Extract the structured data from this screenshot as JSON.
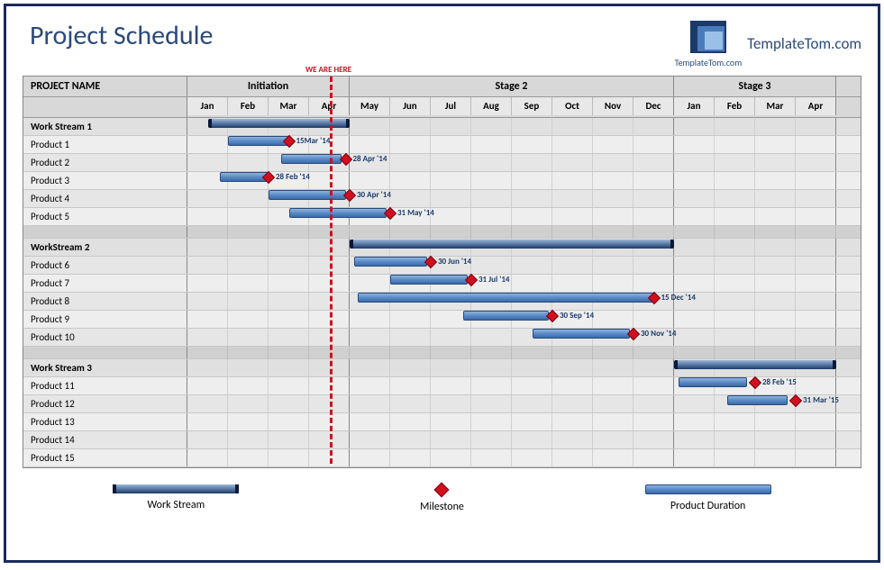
{
  "title": "Project Schedule",
  "brand": {
    "name_small": "TemplateTom.com",
    "name_big": "TemplateTom.com"
  },
  "now_label": "WE ARE HERE",
  "table": {
    "name_header": "PROJECT NAME",
    "groups": [
      {
        "label": "Initiation",
        "span": 4
      },
      {
        "label": "Stage 2",
        "span": 8
      },
      {
        "label": "Stage 3",
        "span": 4
      }
    ],
    "months": [
      "Jan",
      "Feb",
      "Mar",
      "Apr",
      "May",
      "Jun",
      "Jul",
      "Aug",
      "Sep",
      "Oct",
      "Nov",
      "Dec",
      "Jan",
      "Feb",
      "Mar",
      "Apr"
    ]
  },
  "legend": {
    "workstream": "Work Stream",
    "milestone": "Milestone",
    "product": "Product Duration"
  },
  "chart_data": {
    "type": "gantt",
    "title": "Project Schedule",
    "x_unit": "month",
    "x_domain": [
      "2014-01",
      "2015-04"
    ],
    "now": "2014-04-15",
    "streams": [
      {
        "name": "Work Stream 1",
        "bar": {
          "start": 0.5,
          "end": 4.0
        },
        "products": [
          {
            "name": "Product 1",
            "start": 1.0,
            "end": 2.5,
            "milestone": 2.5,
            "label": "15Mar '14"
          },
          {
            "name": "Product 2",
            "start": 2.3,
            "end": 3.8,
            "milestone": 3.9,
            "label": "28 Apr '14"
          },
          {
            "name": "Product 3",
            "start": 0.8,
            "end": 2.0,
            "milestone": 2.0,
            "label": "28 Feb '14"
          },
          {
            "name": "Product 4",
            "start": 2.0,
            "end": 3.9,
            "milestone": 4.0,
            "label": "30 Apr '14"
          },
          {
            "name": "Product 5",
            "start": 2.5,
            "end": 4.9,
            "milestone": 5.0,
            "label": "31 May '14"
          }
        ]
      },
      {
        "name": "WorkStream 2",
        "bar": {
          "start": 4.0,
          "end": 12.0
        },
        "products": [
          {
            "name": "Product 6",
            "start": 4.1,
            "end": 5.9,
            "milestone": 6.0,
            "label": "30 Jun '14"
          },
          {
            "name": "Product 7",
            "start": 5.0,
            "end": 6.9,
            "milestone": 7.0,
            "label": "31 Jul '14"
          },
          {
            "name": "Product 8",
            "start": 4.2,
            "end": 11.5,
            "milestone": 11.5,
            "label": "15 Dec '14"
          },
          {
            "name": "Product 9",
            "start": 6.8,
            "end": 8.9,
            "milestone": 9.0,
            "label": "30 Sep '14"
          },
          {
            "name": "Product 10",
            "start": 8.5,
            "end": 10.9,
            "milestone": 11.0,
            "label": "30 Nov '14"
          }
        ]
      },
      {
        "name": "Work Stream 3",
        "bar": {
          "start": 12.0,
          "end": 16.0
        },
        "products": [
          {
            "name": "Product 11",
            "start": 12.1,
            "end": 13.8,
            "milestone": 14.0,
            "label": "28 Feb '15"
          },
          {
            "name": "Product 12",
            "start": 13.3,
            "end": 14.8,
            "milestone": 15.0,
            "label": "31 Mar '15"
          },
          {
            "name": "Product 13"
          },
          {
            "name": "Product 14"
          },
          {
            "name": "Product 15"
          }
        ]
      }
    ]
  }
}
